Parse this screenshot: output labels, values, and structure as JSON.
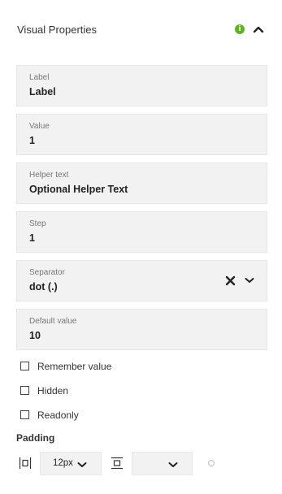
{
  "header": {
    "title": "Visual Properties",
    "info_glyph": "i"
  },
  "fields": {
    "label": {
      "label": "Label",
      "value": "Label"
    },
    "value": {
      "label": "Value",
      "value": "1"
    },
    "helper": {
      "label": "Helper text",
      "value": "Optional Helper Text"
    },
    "step": {
      "label": "Step",
      "value": "1"
    },
    "separator": {
      "label": "Separator",
      "value": "dot (.)"
    },
    "default_value": {
      "label": "Default value",
      "value": "10"
    }
  },
  "checkboxes": {
    "remember": {
      "label": "Remember value",
      "checked": false
    },
    "hidden": {
      "label": "Hidden",
      "checked": false
    },
    "readonly": {
      "label": "Readonly",
      "checked": false
    }
  },
  "padding": {
    "title": "Padding",
    "horizontal": {
      "icon": "padding-horizontal-icon",
      "value": "12px"
    },
    "vertical": {
      "icon": "padding-vertical-icon",
      "value": ""
    }
  },
  "colors": {
    "info_green": "#5fb320",
    "field_bg": "#f2f2f2"
  }
}
